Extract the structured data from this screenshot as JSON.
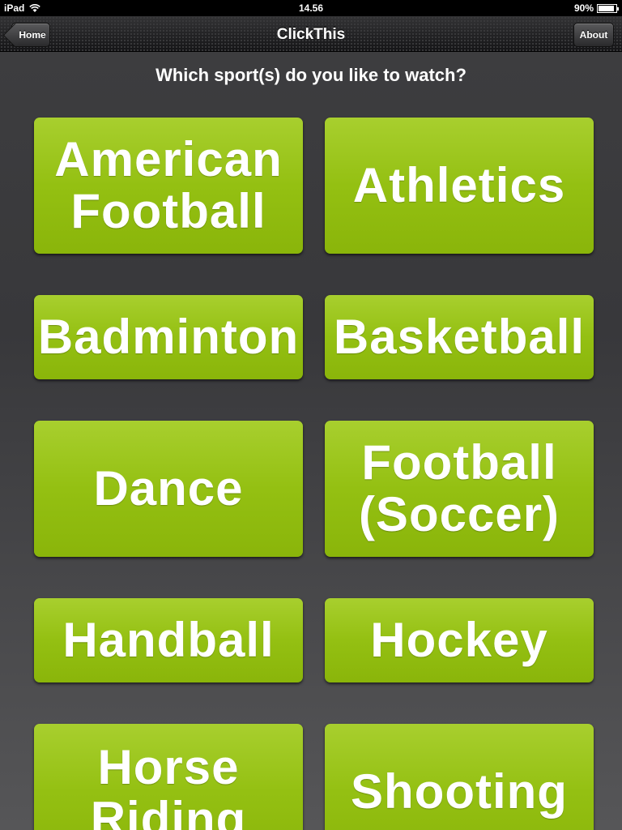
{
  "status_bar": {
    "device": "iPad",
    "time": "14.56",
    "battery": "90%",
    "battery_level": 0.9
  },
  "nav": {
    "title": "ClickThis",
    "home_label": "Home",
    "about_label": "About"
  },
  "question": "Which sport(s) do you like to watch?",
  "options": [
    "American Football",
    "Athletics",
    "Badminton",
    "Basketball",
    "Dance",
    "Football (Soccer)",
    "Handball",
    "Hockey",
    "Horse Riding",
    "Shooting"
  ],
  "colors": {
    "button_green": "#94c012",
    "background": "#3a3a3d"
  }
}
